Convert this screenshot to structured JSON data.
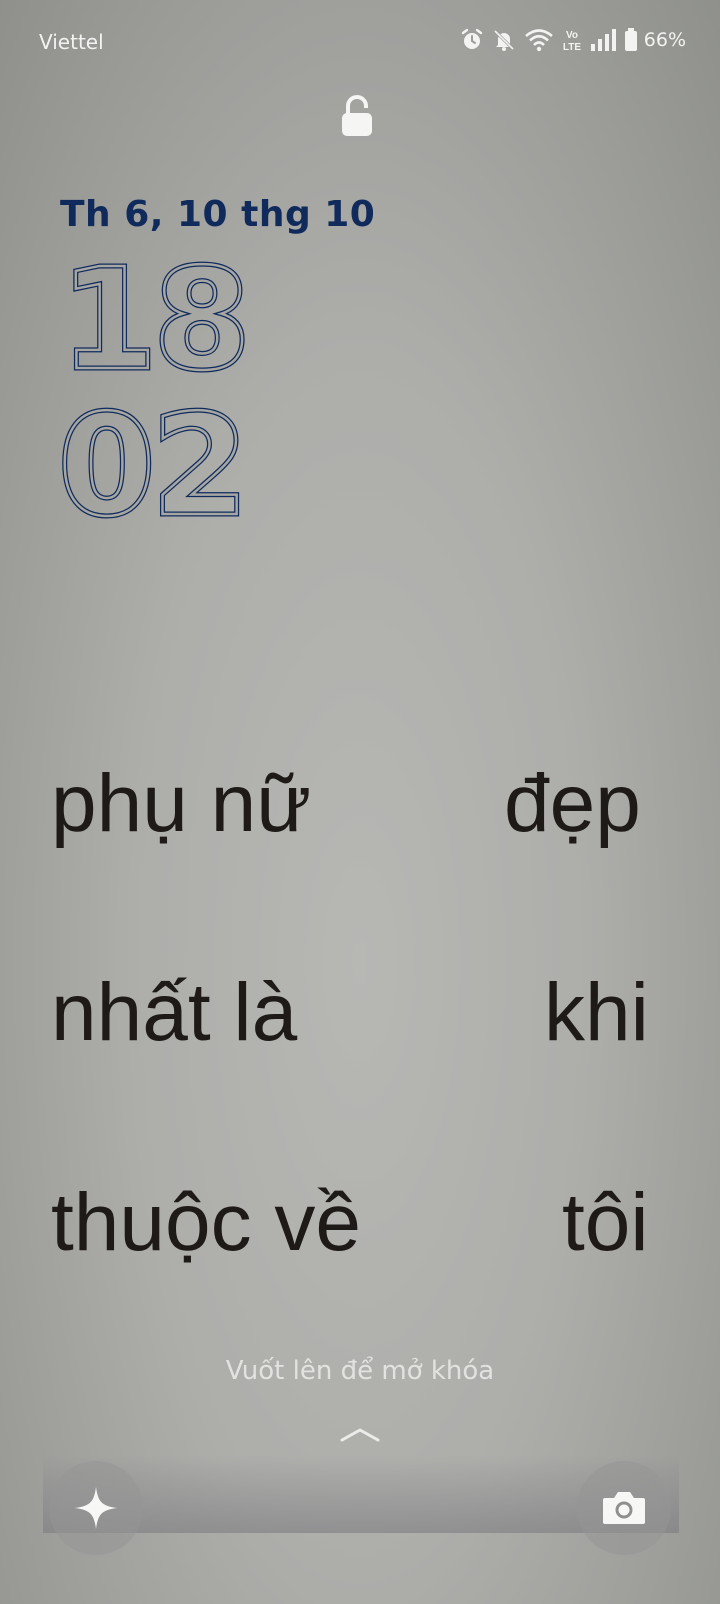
{
  "status_bar": {
    "carrier": "Viettel",
    "battery_percent": "66%",
    "icons": [
      "alarm-icon",
      "mute-icon",
      "wifi-icon",
      "volte-icon",
      "signal-icon",
      "battery-icon"
    ]
  },
  "lock_screen": {
    "lock_icon": "lock-icon",
    "date": "Th 6, 10 thg 10",
    "hour": "18",
    "minute": "02",
    "clock_color": "#102a5c",
    "unlock_hint": "Vuốt lên để mở khóa",
    "left_shortcut_icon": "sparkle-icon",
    "right_shortcut_icon": "camera-icon"
  },
  "wallpaper": {
    "words": {
      "w1": "phụ nữ",
      "w2": "đẹp",
      "w3": "nhất là",
      "w4": "khi",
      "w5": "thuộc về",
      "w6": "tôi"
    }
  }
}
